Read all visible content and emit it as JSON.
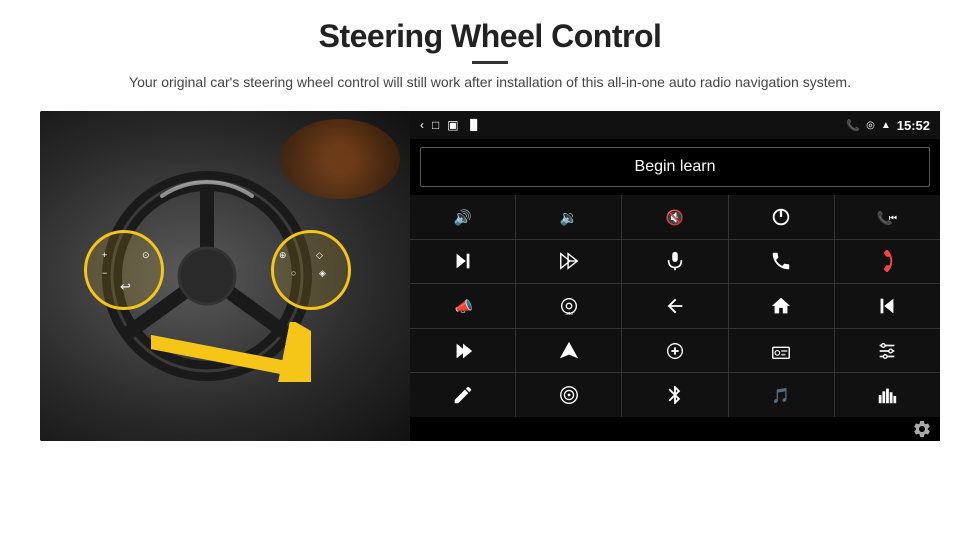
{
  "header": {
    "title": "Steering Wheel Control",
    "subtitle": "Your original car's steering wheel control will still work after installation of this all-in-one auto radio navigation system."
  },
  "android_panel": {
    "status_bar": {
      "time": "15:52",
      "icons": [
        "back-arrow",
        "home-square",
        "recent-square",
        "signal-icon",
        "gps-icon",
        "wifi-icon",
        "phone-icon"
      ]
    },
    "begin_learn_label": "Begin learn",
    "controls": [
      {
        "id": "vol-up",
        "icon": "vol-up"
      },
      {
        "id": "vol-down",
        "icon": "vol-down"
      },
      {
        "id": "mute",
        "icon": "mute"
      },
      {
        "id": "power",
        "icon": "power"
      },
      {
        "id": "prev-track-phone",
        "icon": "prev-track-phone"
      },
      {
        "id": "skip-fwd",
        "icon": "skip-fwd"
      },
      {
        "id": "shuffle",
        "icon": "shuffle"
      },
      {
        "id": "mic",
        "icon": "mic"
      },
      {
        "id": "phone",
        "icon": "phone"
      },
      {
        "id": "hangup",
        "icon": "hangup"
      },
      {
        "id": "horn",
        "icon": "horn"
      },
      {
        "id": "camera360",
        "icon": "camera360"
      },
      {
        "id": "back",
        "icon": "back"
      },
      {
        "id": "home",
        "icon": "home"
      },
      {
        "id": "prev-media",
        "icon": "prev-media"
      },
      {
        "id": "fast-fwd",
        "icon": "fast-fwd"
      },
      {
        "id": "nav",
        "icon": "nav"
      },
      {
        "id": "eq",
        "icon": "eq"
      },
      {
        "id": "radio",
        "icon": "radio"
      },
      {
        "id": "settings-eq",
        "icon": "settings-eq"
      },
      {
        "id": "edit",
        "icon": "edit"
      },
      {
        "id": "target",
        "icon": "target"
      },
      {
        "id": "bluetooth",
        "icon": "bluetooth"
      },
      {
        "id": "music-settings",
        "icon": "music-settings"
      },
      {
        "id": "equalizer",
        "icon": "equalizer"
      }
    ]
  }
}
